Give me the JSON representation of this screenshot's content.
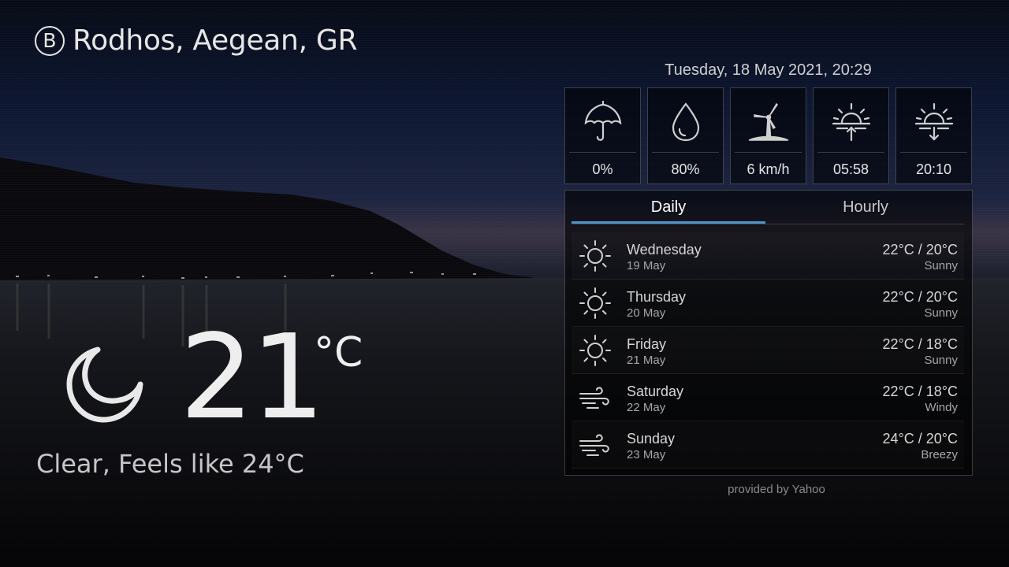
{
  "header": {
    "logo_letter": "B",
    "location": "Rodhos, Aegean, GR"
  },
  "datetime": "Tuesday, 18 May 2021, 20:29",
  "stats": [
    {
      "icon": "umbrella-icon",
      "value": "0%"
    },
    {
      "icon": "humidity-drop-icon",
      "value": "80%"
    },
    {
      "icon": "wind-turbine-icon",
      "value": "6 km/h"
    },
    {
      "icon": "sunrise-icon",
      "value": "05:58"
    },
    {
      "icon": "sunset-icon",
      "value": "20:10"
    }
  ],
  "tabs": {
    "daily": "Daily",
    "hourly": "Hourly",
    "active": "daily"
  },
  "forecast": [
    {
      "day": "Wednesday",
      "date": "19 May",
      "temps": "22°C / 20°C",
      "condition": "Sunny",
      "icon": "sun-icon"
    },
    {
      "day": "Thursday",
      "date": "20 May",
      "temps": "22°C / 20°C",
      "condition": "Sunny",
      "icon": "sun-icon"
    },
    {
      "day": "Friday",
      "date": "21 May",
      "temps": "22°C / 18°C",
      "condition": "Sunny",
      "icon": "sun-icon"
    },
    {
      "day": "Saturday",
      "date": "22 May",
      "temps": "22°C / 18°C",
      "condition": "Windy",
      "icon": "wind-icon"
    },
    {
      "day": "Sunday",
      "date": "23 May",
      "temps": "24°C / 20°C",
      "condition": "Breezy",
      "icon": "wind-icon"
    }
  ],
  "current": {
    "icon": "moon-icon",
    "temperature": "21",
    "unit": "°C",
    "condition": "Clear,",
    "feels_like": "Feels like 24°C"
  },
  "provider": "provided by Yahoo",
  "colors": {
    "accent": "#4a95c9"
  }
}
